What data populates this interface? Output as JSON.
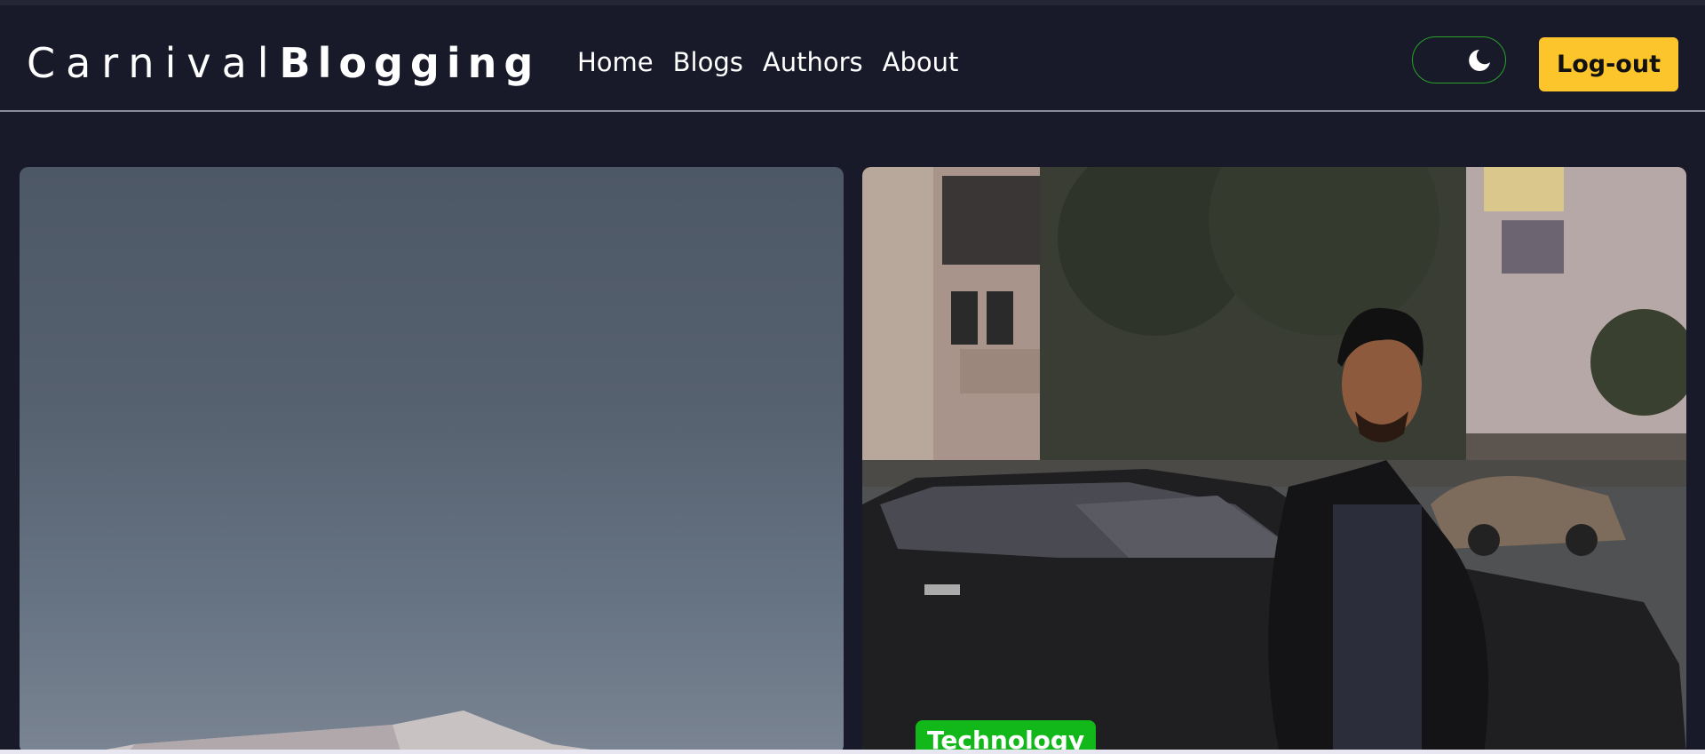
{
  "brand": {
    "part1": "Carnival",
    "part2": "Blogging"
  },
  "nav": {
    "items": [
      "Home",
      "Blogs",
      "Authors",
      "About"
    ]
  },
  "theme_toggle": {
    "icon": "moon-icon",
    "border_color": "#27a327"
  },
  "logout": {
    "label": "Log-out",
    "color": "#fcc52b"
  },
  "posts": [
    {
      "image": "tent-under-sky-photo"
    },
    {
      "image": "man-beside-car-photo",
      "category": "Technology",
      "category_color": "#12b81a"
    }
  ]
}
